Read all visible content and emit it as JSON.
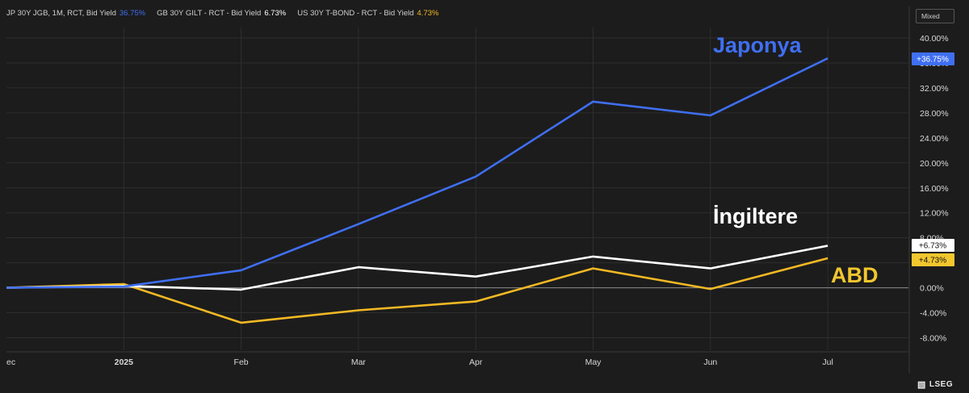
{
  "legend": [
    {
      "label": "JP 30Y JGB, 1M, RCT, Bid Yield",
      "value": "36.75%",
      "color": "#3f6ff2"
    },
    {
      "label": "GB 30Y GILT - RCT - Bid Yield",
      "value": "6.73%",
      "color": "#ffffff"
    },
    {
      "label": "US 30Y T-BOND - RCT - Bid Yield",
      "value": "4.73%",
      "color": "#f2b824"
    }
  ],
  "mode_label": "Mixed",
  "brand": "LSEG",
  "chart_data": {
    "type": "line",
    "x": [
      "Dec",
      "2025",
      "Feb",
      "Mar",
      "Apr",
      "May",
      "Jun",
      "Jul"
    ],
    "x_tick_labels": [
      "ec",
      "2025",
      "Feb",
      "Mar",
      "Apr",
      "May",
      "Jun",
      "Jul"
    ],
    "y_tick_labels": [
      "40.00%",
      "36.00%",
      "32.00%",
      "28.00%",
      "24.00%",
      "20.00%",
      "16.00%",
      "12.00%",
      "8.00%",
      "4.00%",
      "0.00%",
      "-4.00%",
      "-8.00%"
    ],
    "ylim": [
      -10.5,
      41.5
    ],
    "grid": true,
    "series": [
      {
        "name": "JP 30Y JGB, 1M, RCT, Bid Yield",
        "color": "#3f6ff2",
        "values": [
          0.0,
          0.2,
          2.8,
          10.2,
          17.8,
          29.8,
          27.6,
          36.75
        ],
        "end_tag": "+36.75%"
      },
      {
        "name": "GB 30Y GILT - RCT - Bid Yield",
        "color": "#ffffff",
        "values": [
          0.0,
          0.3,
          -0.3,
          3.3,
          1.8,
          5.0,
          3.1,
          6.73
        ],
        "end_tag": "+6.73%"
      },
      {
        "name": "US 30Y T-BOND - RCT - Bid Yield",
        "color": "#f2b824",
        "values": [
          0.0,
          0.6,
          -5.6,
          -3.6,
          -2.2,
          3.1,
          -0.2,
          4.73
        ],
        "end_tag": "+4.73%"
      }
    ],
    "annotations": [
      {
        "text": "Japonya",
        "color": "#3f6ff2",
        "series": 0
      },
      {
        "text": "İngiltere",
        "color": "#ffffff",
        "series": 1
      },
      {
        "text": "ABD",
        "color": "#f2c72e",
        "series": 2
      }
    ]
  }
}
